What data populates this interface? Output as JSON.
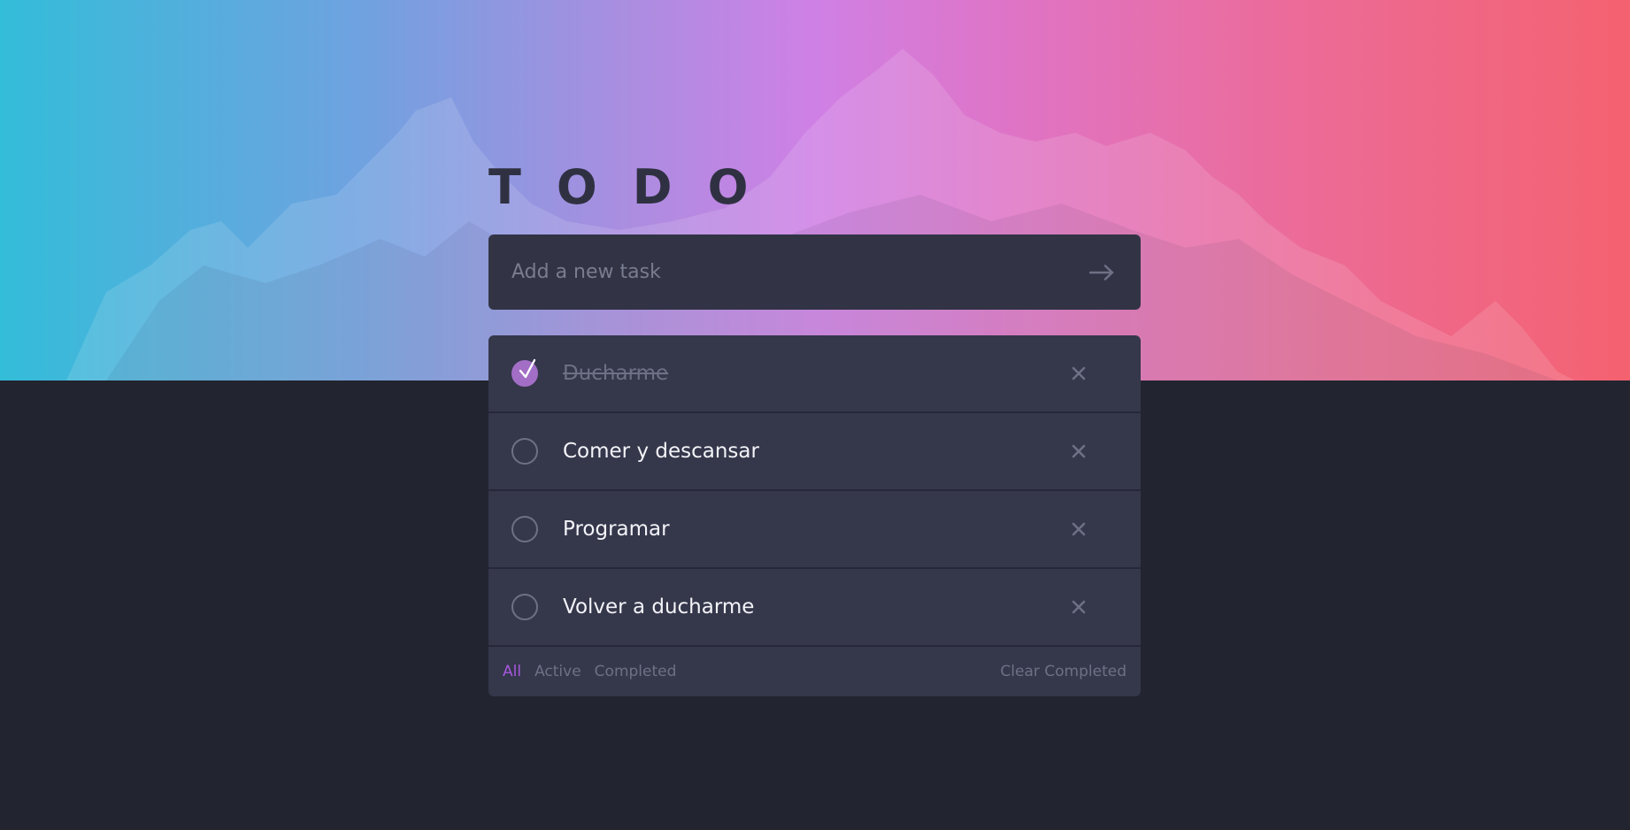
{
  "app": {
    "title": "TODO"
  },
  "new_task": {
    "placeholder": "Add a new task",
    "value": ""
  },
  "tasks": [
    {
      "text": "Ducharme",
      "completed": true
    },
    {
      "text": "Comer y descansar",
      "completed": false
    },
    {
      "text": "Programar",
      "completed": false
    },
    {
      "text": "Volver a ducharme",
      "completed": false
    }
  ],
  "footer": {
    "filters": [
      {
        "label": "All",
        "active": true
      },
      {
        "label": "Active",
        "active": false
      },
      {
        "label": "Completed",
        "active": false
      }
    ],
    "clear_label": "Clear Completed"
  },
  "colors": {
    "background": "#22242f",
    "card": "#35374b",
    "input": "#323446",
    "accent": "#a659dd",
    "check_done": "#a26ec6",
    "muted": "#6e7085",
    "gradient_start": "#33bdd9",
    "gradient_end": "#f46270"
  },
  "icons": {
    "submit": "arrow-right-icon",
    "delete": "close-icon",
    "check": "checkmark-icon"
  }
}
